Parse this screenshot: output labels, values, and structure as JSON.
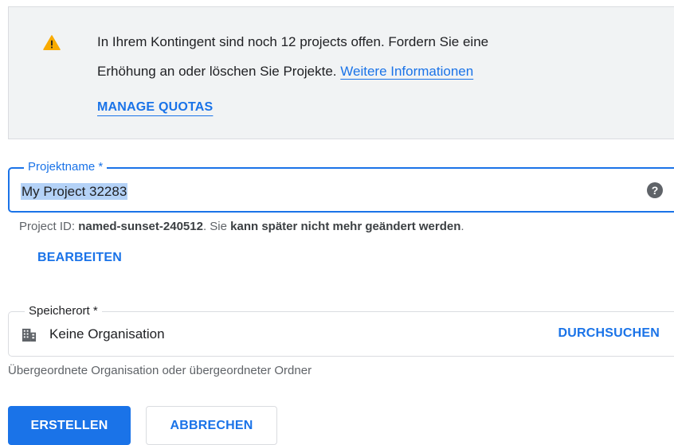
{
  "notice": {
    "text_line1": "In Ihrem Kontingent sind noch 12 projects offen. Fordern Sie eine",
    "text_line2": "Erhöhung an oder löschen Sie Projekte.",
    "more_info_link": "Weitere Informationen",
    "manage_quotas": "MANAGE QUOTAS",
    "icon": "warning-icon",
    "icon_color": "#f9ab00"
  },
  "project_name": {
    "label": "Projektname *",
    "value": "My Project 32283",
    "help_icon": "help-icon"
  },
  "project_id": {
    "prefix": "Project ID:",
    "id": "named-sunset-240512",
    "suffix_plain": ". Sie",
    "suffix_bold": "kann später nicht mehr geändert werden",
    "suffix_end": ".",
    "edit_label": "BEARBEITEN"
  },
  "location": {
    "label": "Speicherort *",
    "value": "Keine Organisation",
    "icon": "organization-icon",
    "browse_label": "DURCHSUCHEN",
    "helper": "Übergeordnete Organisation oder übergeordneter Ordner"
  },
  "actions": {
    "create_label": "ERSTELLEN",
    "cancel_label": "ABBRECHEN"
  },
  "colors": {
    "accent": "#1a73e8",
    "warning": "#f9ab00",
    "notice_bg": "#f1f3f4"
  }
}
